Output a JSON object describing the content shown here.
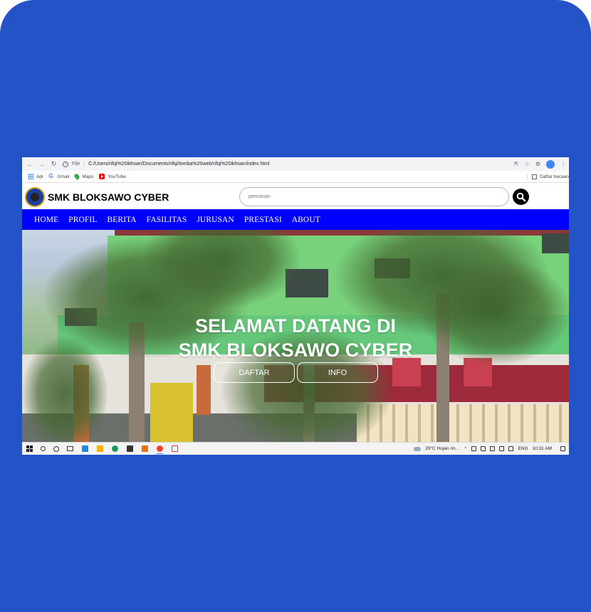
{
  "browser": {
    "file_label": "File",
    "url": "C:/Users/rifqi%20ikhsan/Documents/rifqi/lomba%20web/rifqi%20ikhsan/index.html",
    "bookmarks": [
      {
        "label": "Apl",
        "icon": "apps-icon"
      },
      {
        "label": "Gmail",
        "icon": "gmail-icon"
      },
      {
        "label": "Maps",
        "icon": "maps-icon"
      },
      {
        "label": "YouTube",
        "icon": "youtube-icon"
      }
    ],
    "reading_list": "Daftar bacaan"
  },
  "site": {
    "title": "SMK BLOKSAWO CYBER",
    "search_placeholder": "pencarian",
    "nav": [
      "HOME",
      "PROFIL",
      "BERITA",
      "FASILITAS",
      "JURUSAN",
      "PRESTASI",
      "ABOUT"
    ],
    "hero_line1": "SELAMAT DATANG DI",
    "hero_line2": "SMK BLOKSAWO CYBER",
    "btn_daftar": "DAFTAR",
    "btn_info": "INFO"
  },
  "taskbar": {
    "weather": "29°C  Hujan rin...",
    "lang": "ENG",
    "time": "10:31 AM"
  },
  "colors": {
    "frame": "#2353c7",
    "nav_bg": "#0000fe",
    "site_title": "#000000"
  }
}
